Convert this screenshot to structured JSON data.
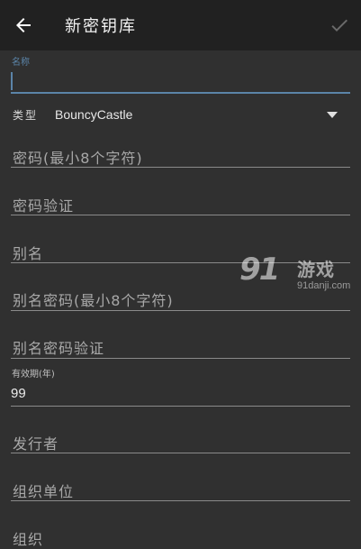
{
  "app_bar": {
    "title": "新密钥库",
    "back_icon": "arrow-left-icon",
    "confirm_icon": "check-icon"
  },
  "form": {
    "name_field": {
      "floating_label": "名称",
      "value": ""
    },
    "type_field": {
      "label": "类型",
      "selected": "BouncyCastle",
      "dropdown_icon": "triangle-down-icon"
    },
    "password_hint": "密码(最小8个字符)",
    "password_confirm_hint": "密码验证",
    "alias_hint": "别名",
    "alias_password_hint": "别名密码(最小8个字符)",
    "alias_password_confirm_hint": "别名密码验证",
    "validity_field": {
      "label": "有效期(年)",
      "value": "99"
    },
    "issuer_hint": "发行者",
    "org_unit_hint": "组织单位",
    "org_hint": "组织"
  },
  "watermark": {
    "logo": "91",
    "text": "游戏",
    "url": "91danji.com"
  },
  "colors": {
    "app_bar_bg": "#212121",
    "content_bg": "#303030",
    "accent": "#5b84a8"
  }
}
